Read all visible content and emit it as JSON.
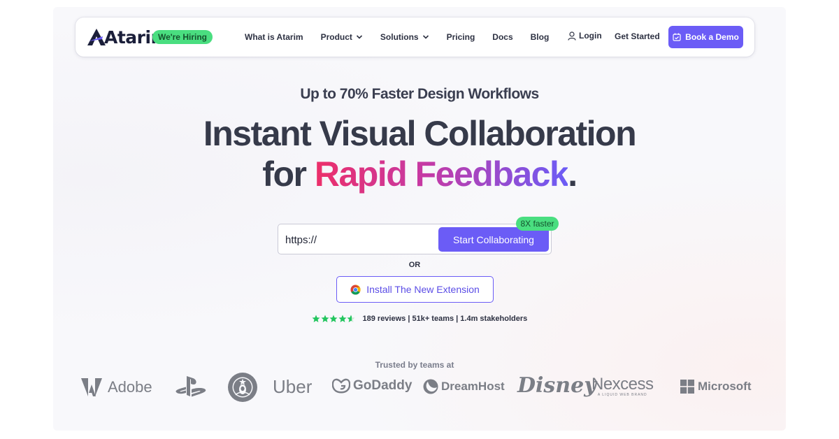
{
  "nav": {
    "brand": "Atarim",
    "hiring_badge": "We're Hiring",
    "menu": [
      {
        "label": "What is Atarim",
        "dropdown": false
      },
      {
        "label": "Product",
        "dropdown": true
      },
      {
        "label": "Solutions",
        "dropdown": true
      },
      {
        "label": "Pricing",
        "dropdown": false
      },
      {
        "label": "Docs",
        "dropdown": false
      },
      {
        "label": "Blog",
        "dropdown": false
      }
    ],
    "login": "Login",
    "get_started": "Get Started",
    "book_demo": "Book a Demo"
  },
  "hero": {
    "eyebrow": "Up to 70% Faster Design Workflows",
    "headline_line1": "Instant Visual Collaboration",
    "headline_line2_prefix": "for ",
    "headline_line2_highlight": "Rapid Feedback",
    "headline_line2_suffix": "."
  },
  "form": {
    "url_value": "https://",
    "submit_label": "Start Collaborating",
    "speed_badge": "8X faster",
    "or_label": "OR",
    "extension_label": "Install The New Extension"
  },
  "social_proof": {
    "stars": 5,
    "text": "189 reviews | 51k+ teams | 1.4m stakeholders",
    "trusted_label": "Trusted by teams at"
  },
  "logos": {
    "adobe": "Adobe",
    "uber": "Uber",
    "godaddy": "GoDaddy",
    "dreamhost": "DreamHost",
    "disney": "Disney",
    "nexcess": "Nexcess",
    "nexcess_tag": "A LIQUID WEB BRAND",
    "microsoft": "Microsoft"
  },
  "colors": {
    "accent": "#6b5cf6",
    "badge_green": "#4ade80",
    "gradient_start": "#ec2f6a",
    "gradient_end": "#6b5cf6",
    "star_green": "#22c55e"
  }
}
